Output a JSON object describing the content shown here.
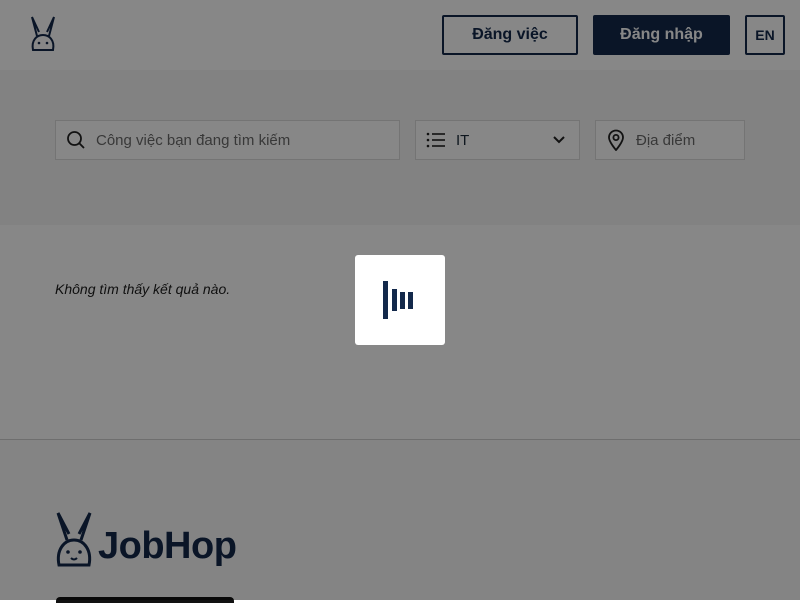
{
  "header": {
    "logo_icon": "rabbit-logo-icon",
    "post_job_label": "Đăng việc",
    "login_label": "Đăng nhập",
    "lang_label": "EN"
  },
  "search": {
    "keyword_placeholder": "Công việc bạn đang tìm kiếm",
    "category_value": "IT",
    "location_placeholder": "Địa điểm",
    "icons": {
      "keyword": "search-icon",
      "category": "list-icon",
      "dropdown": "chevron-down-icon",
      "location": "map-pin-icon"
    }
  },
  "results": {
    "empty_text": "Không tìm thấy kết quả nào."
  },
  "footer": {
    "brand": "JobHop"
  },
  "loader": {
    "icon": "loading-bars-icon"
  },
  "colors": {
    "brand_navy": "#13294b",
    "overlay": "rgba(0,0,0,0.47)"
  }
}
